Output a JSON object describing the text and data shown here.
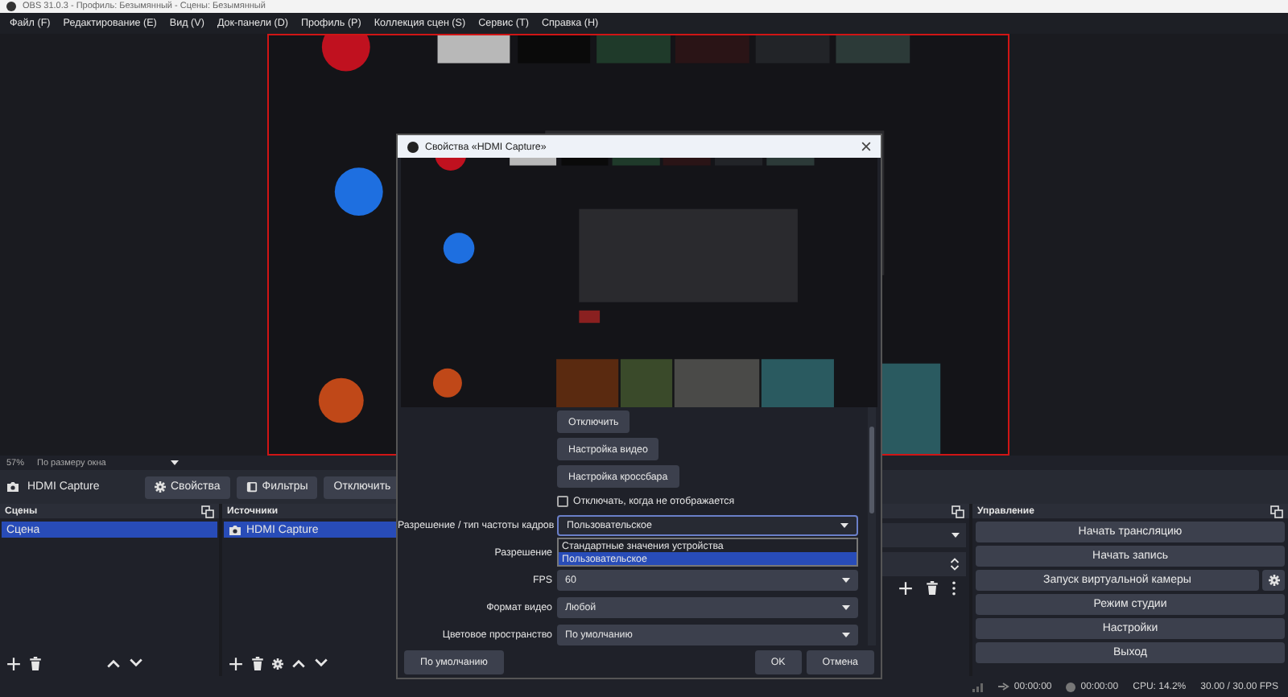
{
  "window": {
    "title": "OBS 31.0.3 - Профиль: Безымянный - Сцены: Безымянный"
  },
  "menu": [
    "Файл (F)",
    "Редактирование (E)",
    "Вид (V)",
    "Док-панели (D)",
    "Профиль (P)",
    "Коллекция сцен (S)",
    "Сервис (T)",
    "Справка (H)"
  ],
  "zoom": {
    "percent": "57%",
    "scale_mode": "По размеру окна"
  },
  "source_toolbar": {
    "source": "HDMI Capture",
    "buttons": [
      {
        "label": "Свойства",
        "kind": "gear"
      },
      {
        "label": "Фильтры",
        "kind": "filter"
      },
      {
        "label": "Отключить",
        "kind": "plain"
      }
    ]
  },
  "scenes": {
    "title": "Сцены",
    "items": [
      {
        "label": "Сцена",
        "selected": true
      }
    ]
  },
  "sources": {
    "title": "Источники",
    "items": [
      {
        "label": "HDMI Capture",
        "selected": true
      }
    ]
  },
  "controls": {
    "title": "Управление",
    "buttons": [
      {
        "label": "Начать трансляцию",
        "kind": "plain"
      },
      {
        "label": "Начать запись",
        "kind": "plain"
      },
      {
        "label": "Запуск виртуальной камеры",
        "kind": "gear"
      },
      {
        "label": "Режим студии",
        "kind": "plain"
      },
      {
        "label": "Настройки",
        "kind": "plain"
      },
      {
        "label": "Выход",
        "kind": "plain"
      }
    ]
  },
  "status_bar": {
    "stream_time": "00:00:00",
    "record_time": "00:00:00",
    "cpu": "CPU: 14.2%",
    "fps": "30.00 / 30.00 FPS"
  },
  "dialog": {
    "title": "Свойства «HDMI Capture»",
    "buttons": [
      "Отключить",
      "Настройка видео",
      "Настройка кроссбара"
    ],
    "checkbox": {
      "label": "Отключать, когда не отображается",
      "checked": false
    },
    "fields": [
      {
        "label": "Разрешение / тип частоты кадров",
        "kind": "combo",
        "value": "Пользовательское",
        "open": true,
        "options": [
          {
            "label": "Стандартные значения устройства",
            "selected": false
          },
          {
            "label": "Пользовательское",
            "selected": true
          }
        ]
      },
      {
        "label": "Разрешение",
        "kind": "covered"
      },
      {
        "label": "FPS",
        "kind": "combo",
        "value": "60"
      },
      {
        "label": "Формат видео",
        "kind": "combo",
        "value": "Любой"
      },
      {
        "label": "Цветовое пространство",
        "kind": "combo",
        "value": "По умолчанию"
      }
    ],
    "footer": {
      "defaults": "По умолчанию",
      "ok": "OK",
      "cancel": "Отмена"
    }
  }
}
